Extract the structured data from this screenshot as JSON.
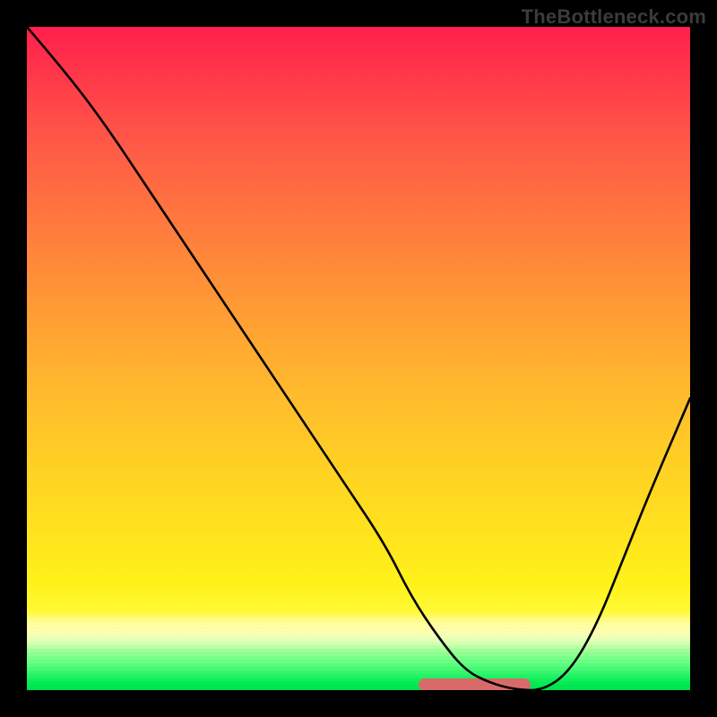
{
  "watermark": "TheBottleneck.com",
  "colors": {
    "flat_highlight": "#d96a6a",
    "curve": "#000000"
  },
  "chart_data": {
    "type": "line",
    "title": "",
    "xlabel": "",
    "ylabel": "",
    "xlim": [
      0,
      100
    ],
    "ylim": [
      0,
      100
    ],
    "grid": false,
    "series": [
      {
        "name": "bottleneck-curve",
        "x": [
          0,
          6,
          12,
          18,
          24,
          30,
          36,
          42,
          48,
          54,
          58,
          62,
          66,
          70,
          74,
          78,
          82,
          86,
          90,
          94,
          100
        ],
        "values": [
          100,
          93,
          85,
          76,
          67,
          58,
          49,
          40,
          31,
          22,
          14,
          8,
          3,
          1,
          0,
          0,
          3,
          10,
          20,
          30,
          44
        ]
      }
    ],
    "annotations": [
      {
        "type": "segment",
        "name": "optimal-range-highlight",
        "x0": 60,
        "x1": 75,
        "y": 0,
        "color": "#d96a6a"
      }
    ]
  }
}
